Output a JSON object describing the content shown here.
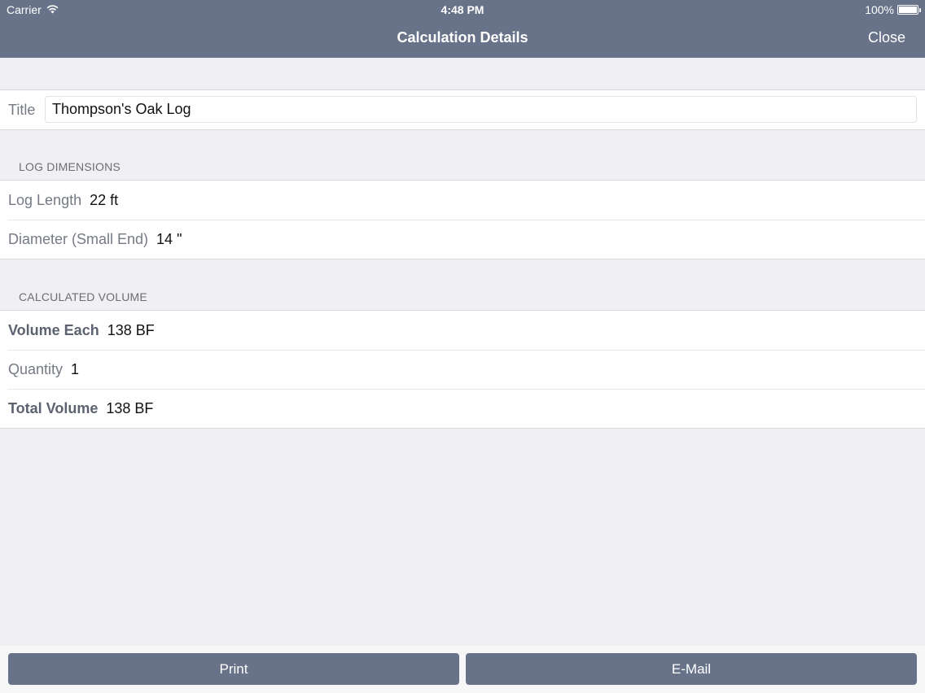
{
  "status": {
    "carrier": "Carrier",
    "time": "4:48 PM",
    "battery": "100%"
  },
  "nav": {
    "title": "Calculation Details",
    "close_label": "Close"
  },
  "title_field": {
    "label": "Title",
    "value": "Thompson's Oak Log"
  },
  "log_dimensions": {
    "header": "LOG DIMENSIONS",
    "rows": [
      {
        "label": "Log Length",
        "value": "22 ft"
      },
      {
        "label": "Diameter (Small End)",
        "value": "14 \""
      }
    ]
  },
  "calculated_volume": {
    "header": "CALCULATED VOLUME",
    "rows": [
      {
        "label": "Volume Each",
        "value": "138 BF"
      },
      {
        "label": "Quantity",
        "value": "1"
      },
      {
        "label": "Total Volume",
        "value": "138 BF"
      }
    ]
  },
  "footer": {
    "print_label": "Print",
    "email_label": "E-Mail"
  },
  "colors": {
    "accent": "#687389",
    "background": "#efeff4"
  }
}
